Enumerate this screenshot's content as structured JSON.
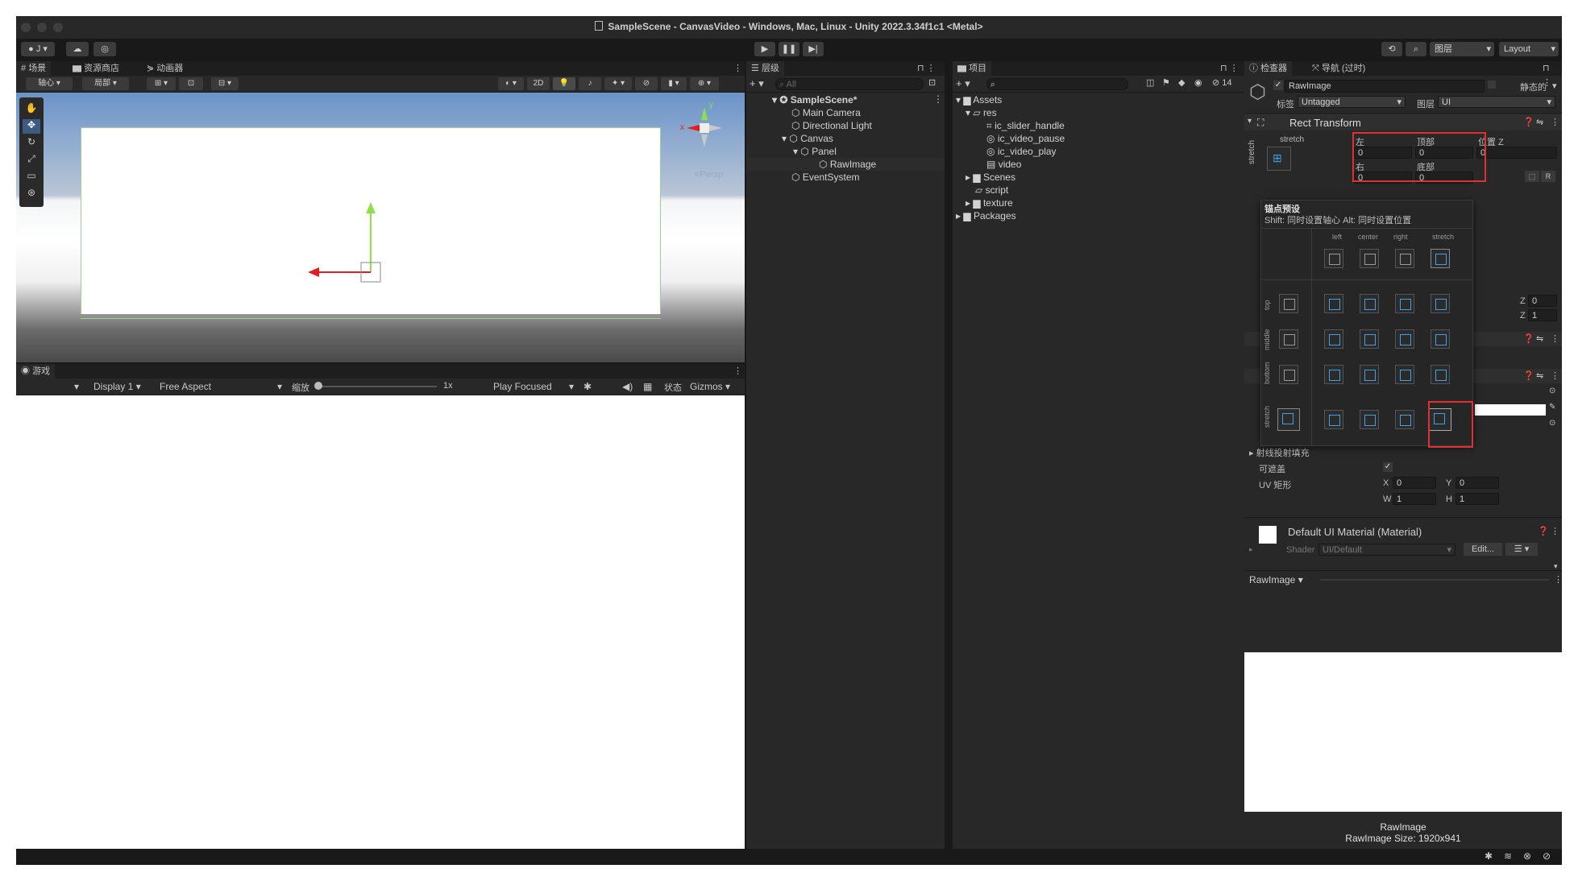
{
  "window": {
    "title": "SampleScene - CanvasVideo - Windows, Mac, Linux - Unity 2022.3.34f1c1 <Metal>"
  },
  "toolbar": {
    "account": "J",
    "layers_label": "图层",
    "layout_label": "Layout"
  },
  "scene_panel": {
    "tabs": [
      "场景",
      "资源商店",
      "动画器"
    ],
    "pivot_label": "轴心",
    "local_label": "局部",
    "mode_2d": "2D",
    "persp_label": "<Persp",
    "gizmo_x": "x",
    "gizmo_y": "y"
  },
  "game_panel": {
    "tab": "游戏",
    "display": "Display 1",
    "aspect": "Free Aspect",
    "scale_label": "缩放",
    "scale_value": "1x",
    "play_mode": "Play Focused",
    "stats_label": "状态",
    "gizmos_label": "Gizmos"
  },
  "hierarchy": {
    "tab": "层级",
    "search_placeholder": "All",
    "items": [
      {
        "label": "SampleScene*",
        "depth": 0
      },
      {
        "label": "Main Camera",
        "depth": 1
      },
      {
        "label": "Directional Light",
        "depth": 1
      },
      {
        "label": "Canvas",
        "depth": 1
      },
      {
        "label": "Panel",
        "depth": 2
      },
      {
        "label": "RawImage",
        "depth": 3
      },
      {
        "label": "EventSystem",
        "depth": 1
      }
    ]
  },
  "project": {
    "tab": "项目",
    "count": "14",
    "items": [
      {
        "label": "Assets",
        "depth": 0
      },
      {
        "label": "res",
        "depth": 1
      },
      {
        "label": "ic_slider_handle",
        "depth": 2
      },
      {
        "label": "ic_video_pause",
        "depth": 2
      },
      {
        "label": "ic_video_play",
        "depth": 2
      },
      {
        "label": "video",
        "depth": 2
      },
      {
        "label": "Scenes",
        "depth": 1
      },
      {
        "label": "script",
        "depth": 1
      },
      {
        "label": "texture",
        "depth": 1
      },
      {
        "label": "Packages",
        "depth": 0
      }
    ]
  },
  "inspector": {
    "tabs": [
      "检查器",
      "导航 (过时)"
    ],
    "object_name": "RawImage",
    "static_label": "静态的",
    "tag_label": "标签",
    "tag_value": "Untagged",
    "layer_label": "图层",
    "layer_value": "UI",
    "rect_transform": {
      "title": "Rect Transform",
      "stretch_top": "stretch",
      "stretch_side": "stretch",
      "left_label": "左",
      "top_label": "顶部",
      "posz_label": "位置 Z",
      "left": "0",
      "top": "0",
      "posz": "0",
      "right_label": "右",
      "bottom_label": "底部",
      "right": "0",
      "bottom": "0",
      "r_button": "R"
    },
    "anchor_popup": {
      "title": "锚点预设",
      "hint": "Shift: 同时设置轴心    Alt: 同时设置位置",
      "cols": [
        "left",
        "center",
        "right",
        "stretch"
      ],
      "rows": [
        "top",
        "middle",
        "bottom",
        "stretch"
      ]
    },
    "scale_z": "0",
    "scale_z2": "1",
    "z_label": "Z",
    "raycast_label": "射线投射填充",
    "maskable_label": "可遮盖",
    "uv_label": "UV 矩形",
    "uv": {
      "x": "0",
      "y": "0",
      "w": "1",
      "h": "1"
    },
    "material_name": "Default UI Material (Material)",
    "shader_label": "Shader",
    "shader_value": "UI/Default",
    "edit_button": "Edit...",
    "preview_title": "RawImage",
    "preview_caption": "RawImage",
    "preview_size": "RawImage Size: 1920x941"
  },
  "colors": {
    "accent": "#3fa0e6",
    "highlight": "#e03030",
    "bg": "#282828"
  }
}
